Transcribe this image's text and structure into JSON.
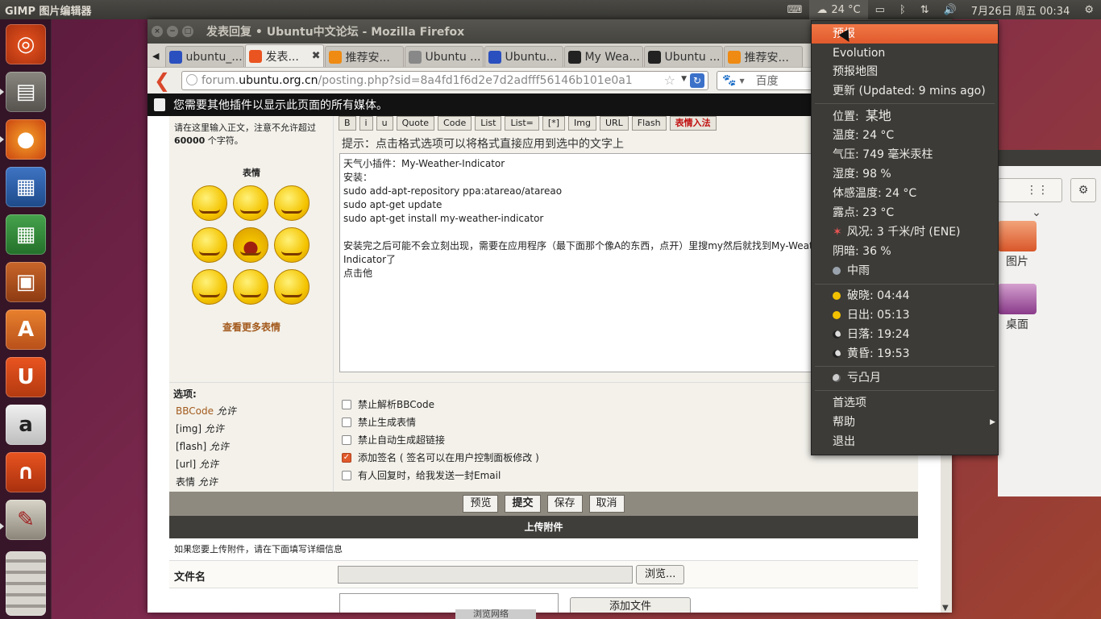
{
  "topbar": {
    "app_title": "GIMP 图片编辑器",
    "temperature": "24 °C",
    "date_time": "7月26日 周五  00:34"
  },
  "firefox": {
    "window_title": "发表回复 • Ubuntu中文论坛 - Mozilla Firefox",
    "tabs": [
      {
        "label": "ubuntu_...",
        "icon": "paw-icon",
        "color": "#2a4fbf",
        "closable": false
      },
      {
        "label": "发表...",
        "icon": "ubuntu-icon",
        "color": "#e95420",
        "closable": true
      },
      {
        "label": "推荐安...",
        "icon": "orange-icon",
        "color": "#ef8a12",
        "closable": false
      },
      {
        "label": "Ubuntu ...",
        "icon": "generic-icon",
        "color": "#888888",
        "closable": false
      },
      {
        "label": "Ubuntu...",
        "icon": "paw-icon",
        "color": "#2a4fbf",
        "closable": false
      },
      {
        "label": "My Wea...",
        "icon": "tux-icon",
        "color": "#222222",
        "closable": false
      },
      {
        "label": "Ubuntu ...",
        "icon": "tux-icon",
        "color": "#222222",
        "closable": false
      },
      {
        "label": "推荐安...",
        "icon": "orange-icon",
        "color": "#ef8a12",
        "closable": false
      }
    ],
    "url_prefix": "forum.",
    "url_host": "ubuntu.org.cn",
    "url_path": "/posting.php?sid=8a4fd1f6d2e7d2adfff56146b101e0a1",
    "search_placeholder": "百度",
    "notification": "您需要其他插件以显示此页面的所有媒体。"
  },
  "form": {
    "left_hint_line1": "请在这里输入正文，注意不允许超过",
    "left_hint_bold": "60000",
    "left_hint_tail": " 个字符。",
    "smileys_title": "表情",
    "more_smileys": "查看更多表情",
    "toolbar_buttons": [
      "B",
      "i",
      "u",
      "Quote",
      "Code",
      "List",
      "List=",
      "[*]",
      "Img",
      "URL",
      "Flash",
      "表情入法"
    ],
    "format_hint": "提示：点击格式选项可以将格式直接应用到选中的文字上",
    "post_text": "天气小插件：My-Weather-Indicator\n安装：\nsudo add-apt-repository ppa:atareao/atareao\nsudo apt-get update\nsudo apt-get install my-weather-indicator\n\n安装完之后可能不会立刻出现，需要在应用程序（最下面那个像A的东西，点开）里搜my然后就找到My-Weath\nIndicator了\n点击他",
    "options_title": "选项:",
    "permissions": [
      {
        "name": "BBCode",
        "state": "允许"
      },
      {
        "name": "[img]",
        "state": "允许"
      },
      {
        "name": "[flash]",
        "state": "允许"
      },
      {
        "name": "[url]",
        "state": "允许"
      },
      {
        "name": "表情",
        "state": "允许"
      }
    ],
    "checkboxes": [
      {
        "label": "禁止解析BBCode",
        "checked": false
      },
      {
        "label": "禁止生成表情",
        "checked": false
      },
      {
        "label": "禁止自动生成超链接",
        "checked": false
      },
      {
        "label": "添加签名 ( 签名可以在用户控制面板修改 )",
        "checked": true
      },
      {
        "label": "有人回复时，给我发送一封Email",
        "checked": false
      }
    ],
    "buttons": {
      "preview": "预览",
      "submit": "提交",
      "save": "保存",
      "cancel": "取消"
    },
    "upload_title": "上传附件",
    "upload_info": "如果您要上传附件，请在下面填写详细信息",
    "file_label": "文件名",
    "browse": "浏览...",
    "add_file": "添加文件"
  },
  "nautilus": {
    "pictures": "图片",
    "desktop": "桌面"
  },
  "weather_menu": {
    "forecast": "预报",
    "evolution": "Evolution",
    "forecast_map": "预报地图",
    "update": "更新 (Updated: 9 mins ago)",
    "location_label": "位置:",
    "location_value": "某地",
    "temperature": "温度: 24 °C",
    "pressure": "气压: 749 毫米汞柱",
    "humidity": "湿度: 98 %",
    "feels_like": "体感温度: 24 °C",
    "dew_point": "露点: 23 °C",
    "wind": "风况: 3 千米/时 (ENE)",
    "cloudiness": "阴暗: 36 %",
    "condition": "中雨",
    "dawn": "破晓: 04:44",
    "sunrise": "日出: 05:13",
    "sunset": "日落: 19:24",
    "dusk": "黄昏: 19:53",
    "moon": "亏凸月",
    "preferences": "首选项",
    "help": "帮助",
    "quit": "退出"
  },
  "taskbar_fragment": "浏览网络"
}
